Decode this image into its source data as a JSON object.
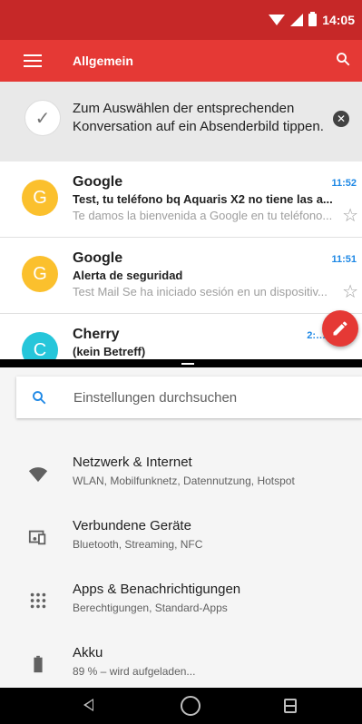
{
  "status_bar": {
    "time": "14:05"
  },
  "app_bar": {
    "title": "Allgemein"
  },
  "tip": {
    "text": "Zum Auswählen der entsprechenden Konversation auf ein Absenderbild tippen."
  },
  "mails": [
    {
      "avatar": "G",
      "avatar_color": "#fbc02d",
      "sender": "Google",
      "time": "11:52",
      "subject": "Test, tu teléfono bq Aquaris X2 no tiene las a...",
      "snippet": "Te damos la bienvenida a Google en tu teléfono..."
    },
    {
      "avatar": "G",
      "avatar_color": "#fbc02d",
      "sender": "Google",
      "time": "11:51",
      "subject": "Alerta de seguridad",
      "snippet": "Test Mail Se ha iniciado sesión en un dispositiv..."
    },
    {
      "avatar": "C",
      "avatar_color": "#26c6da",
      "sender": "Cherry",
      "time": "2:…",
      "subject": "(kein Betreff)",
      "snippet": ""
    }
  ],
  "settings": {
    "search_placeholder": "Einstellungen durchsuchen",
    "items": [
      {
        "icon": "wifi-icon",
        "title": "Netzwerk & Internet",
        "subtitle": "WLAN, Mobilfunknetz, Datennutzung, Hotspot"
      },
      {
        "icon": "devices-icon",
        "title": "Verbundene Geräte",
        "subtitle": "Bluetooth, Streaming, NFC"
      },
      {
        "icon": "apps-icon",
        "title": "Apps & Benachrichtigungen",
        "subtitle": "Berechtigungen, Standard-Apps"
      },
      {
        "icon": "battery-icon",
        "title": "Akku",
        "subtitle": "89 % – wird aufgeladen..."
      }
    ]
  },
  "colors": {
    "status_bar": "#c62828",
    "app_bar": "#e53935",
    "accent_blue": "#1e88e5"
  }
}
